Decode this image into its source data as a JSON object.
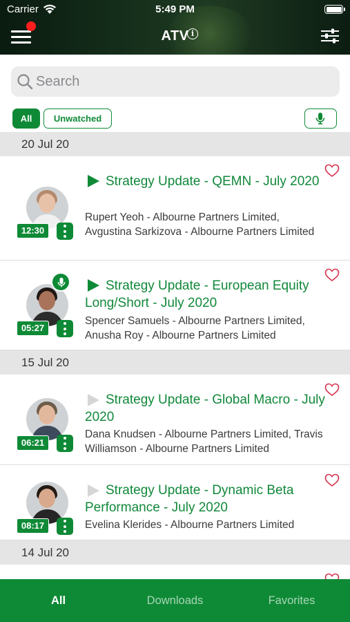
{
  "status_bar": {
    "carrier": "Carrier",
    "time": "5:49 PM"
  },
  "header": {
    "title": "ATV",
    "info_icon": "info-icon",
    "menu_icon": "hamburger-menu-icon",
    "settings_icon": "sliders-icon"
  },
  "search": {
    "placeholder": "Search",
    "value": ""
  },
  "filters": {
    "all_label": "All",
    "unwatched_label": "Unwatched",
    "voice_icon": "microphone-icon",
    "selected": "All"
  },
  "sections": [
    {
      "date": "20 Jul 20",
      "items": [
        {
          "title": "Strategy Update - QEMN - July 2020",
          "presenters": "Rupert Yeoh - Albourne Partners Limited, Avgustina Sarkizova - Albourne Partners Limited",
          "duration": "12:30",
          "watched": false,
          "audio_available": false
        },
        {
          "title": "Strategy Update - European Equity Long/Short - July 2020",
          "presenters": "Spencer Samuels - Albourne Partners Limited, Anusha Roy - Albourne Partners Limited",
          "duration": "05:27",
          "watched": false,
          "audio_available": true
        }
      ]
    },
    {
      "date": "15 Jul 20",
      "items": [
        {
          "title": "Strategy Update - Global Macro - July 2020",
          "presenters": "Dana Knudsen - Albourne Partners Limited, Travis Williamson - Albourne Partners Limited",
          "duration": "06:21",
          "watched": true,
          "audio_available": false
        },
        {
          "title": "Strategy Update - Dynamic Beta Performance - July 2020",
          "presenters": "Evelina Klerides - Albourne Partners Limited",
          "duration": "08:17",
          "watched": true,
          "audio_available": false
        }
      ]
    },
    {
      "date": "14 Jul 20",
      "items": []
    }
  ],
  "tab_bar": {
    "tabs": [
      "All",
      "Downloads",
      "Favorites"
    ],
    "active": "All"
  },
  "colors": {
    "brand_green": "#0e8a36",
    "title_green": "#11883a",
    "heart_red": "#d6314c",
    "section_bg": "#e5e5e6",
    "header_dark": "#16301c"
  }
}
